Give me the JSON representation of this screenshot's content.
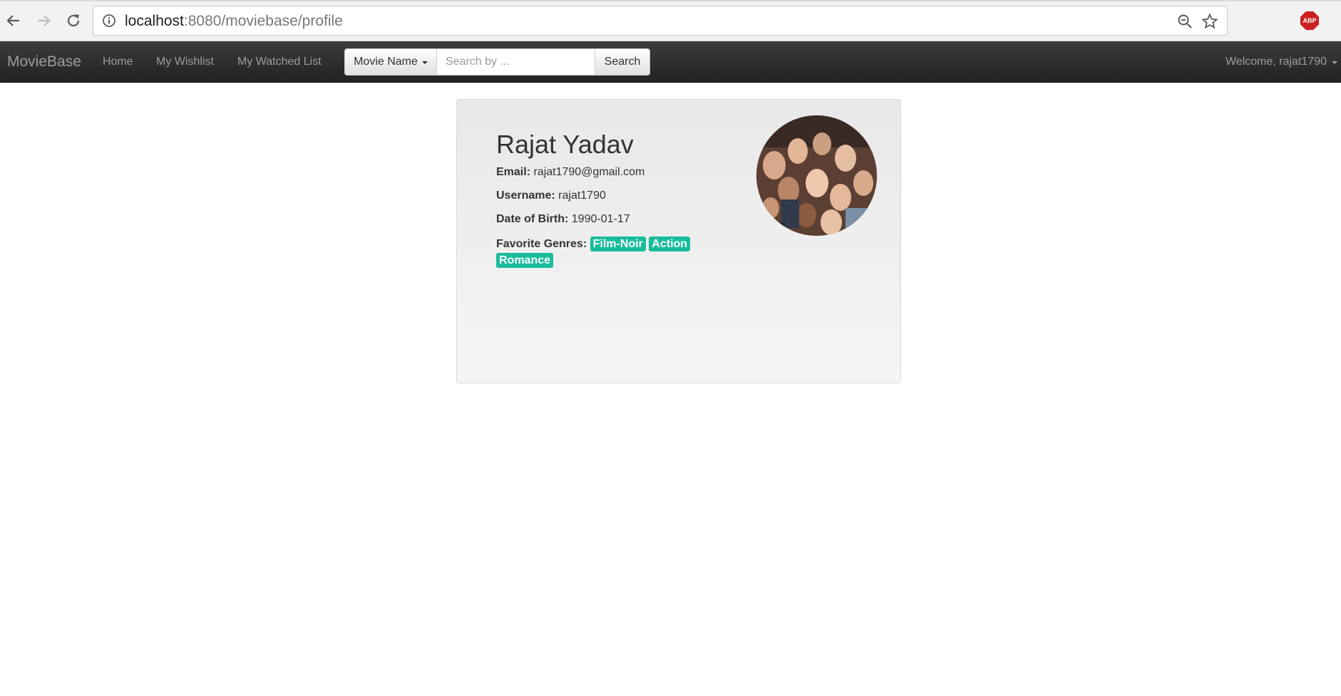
{
  "browser": {
    "url_host": "localhost",
    "url_path": ":8080/moviebase/profile",
    "extension_label": "ABP"
  },
  "navbar": {
    "brand": "MovieBase",
    "links": [
      "Home",
      "My Wishlist",
      "My Watched List"
    ],
    "search": {
      "filter_label": "Movie Name",
      "placeholder": "Search by ...",
      "button_label": "Search"
    },
    "welcome": "Welcome, rajat1790"
  },
  "profile": {
    "name": "Rajat Yadav",
    "email_label": "Email:",
    "email": "rajat1790@gmail.com",
    "username_label": "Username:",
    "username": "rajat1790",
    "dob_label": "Date of Birth:",
    "dob": "1990-01-17",
    "genres_label": "Favorite Genres:",
    "genres": [
      "Film-Noir",
      "Action",
      "Romance"
    ],
    "genre_color": "#18bc9c"
  }
}
